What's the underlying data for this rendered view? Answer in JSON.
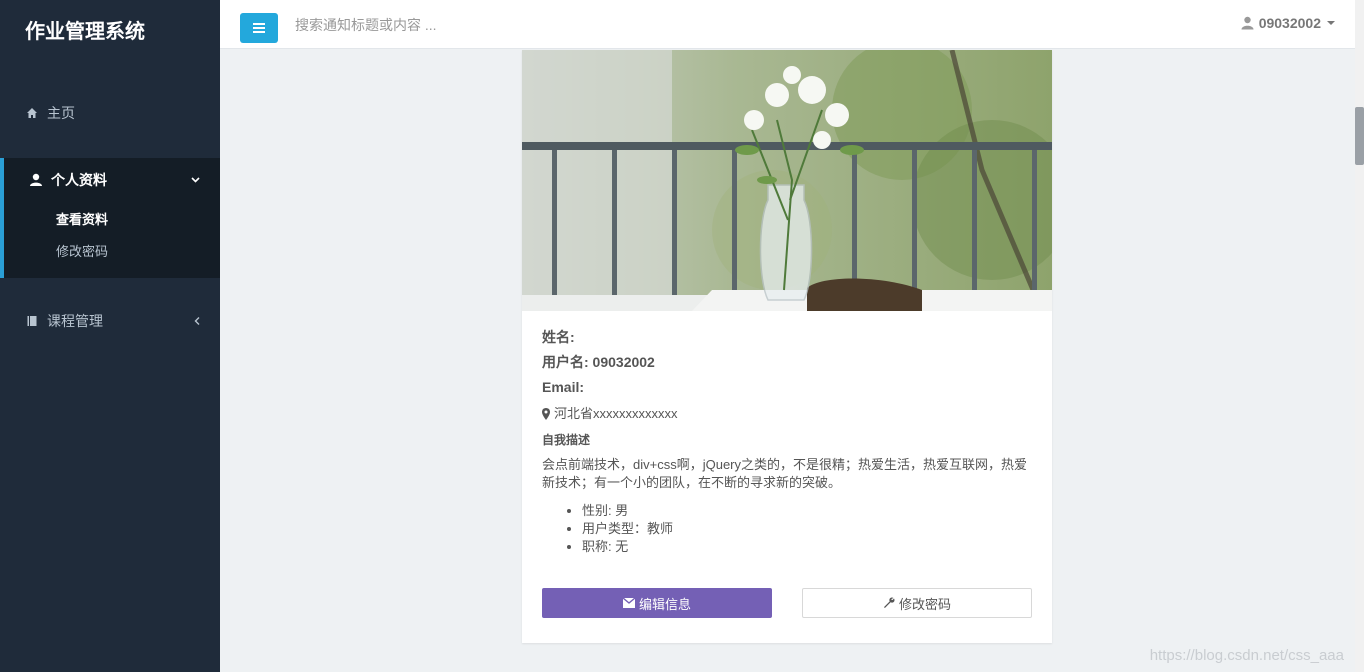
{
  "app": {
    "title": "作业管理系统"
  },
  "sidebar": {
    "items": [
      {
        "label": "主页",
        "icon": "home-icon"
      },
      {
        "label": "个人资料",
        "icon": "user-icon",
        "expanded": true,
        "children": [
          {
            "label": "查看资料",
            "active": true
          },
          {
            "label": "修改密码"
          }
        ]
      },
      {
        "label": "课程管理",
        "icon": "book-icon"
      }
    ]
  },
  "header": {
    "search_placeholder": "搜索通知标题或内容 ...",
    "username": "09032002",
    "toggle_icon": "menu-icon"
  },
  "profile": {
    "name_label": "姓名:",
    "username_line": "用户名: 09032002",
    "email_label": "Email:",
    "location": "河北省xxxxxxxxxxxxx",
    "bio_title": "自我描述",
    "bio": "会点前端技术，div+css啊，jQuery之类的，不是很精；热爱生活，热爱互联网，热爱新技术；有一个小的团队，在不断的寻求新的突破。",
    "details": [
      "性别: 男",
      "用户类型：教师",
      "职称: 无"
    ],
    "edit_button": "编辑信息",
    "password_button": "修改密码"
  },
  "watermark": "https://blog.csdn.net/css_aaa",
  "colors": {
    "sidebar_bg": "#1f2b3a",
    "accent": "#23a8dc",
    "primary_button": "#7460b5"
  }
}
